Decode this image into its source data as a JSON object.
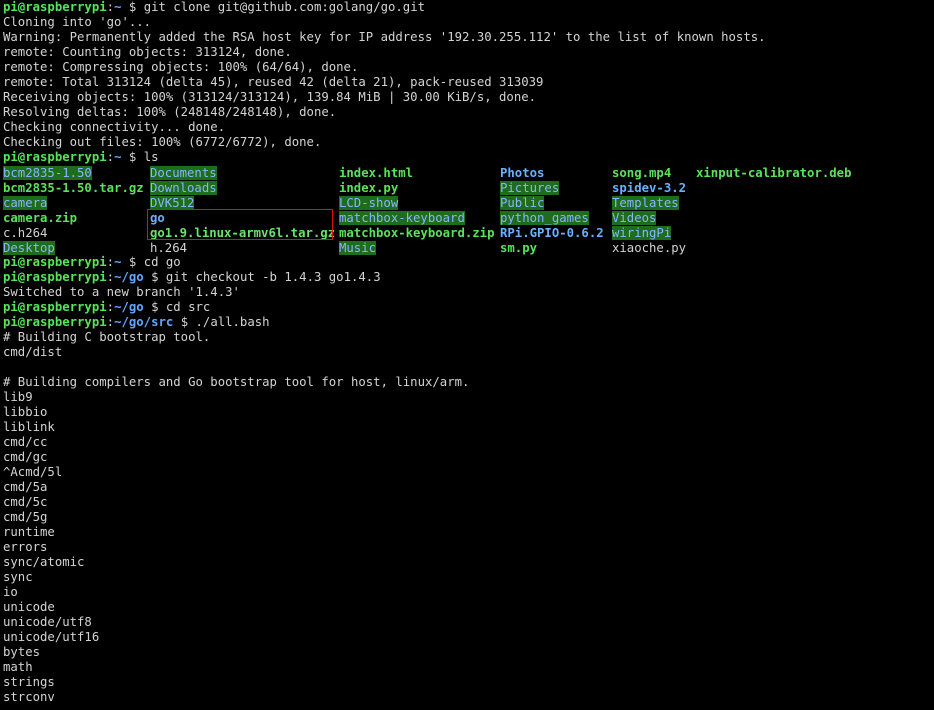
{
  "prompt": {
    "user_host": "pi@raspberrypi",
    "sep": ":"
  },
  "lines_top": [
    {
      "path": "~",
      "cmd": "git clone git@github.com:golang/go.git"
    },
    {
      "text": "Cloning into 'go'..."
    },
    {
      "text": "Warning: Permanently added the RSA host key for IP address '192.30.255.112' to the list of known hosts."
    },
    {
      "text": "remote: Counting objects: 313124, done."
    },
    {
      "text": "remote: Compressing objects: 100% (64/64), done."
    },
    {
      "text": "remote: Total 313124 (delta 45), reused 42 (delta 21), pack-reused 313039"
    },
    {
      "text": "Receiving objects: 100% (313124/313124), 139.84 MiB | 30.00 KiB/s, done."
    },
    {
      "text": "Resolving deltas: 100% (248148/248148), done."
    },
    {
      "text": "Checking connectivity... done."
    },
    {
      "text": "Checking out files: 100% (6772/6772), done."
    },
    {
      "path": "~",
      "cmd": "ls"
    }
  ],
  "ls_rows": [
    [
      "bcm2835-1.50",
      "Documents",
      "index.html",
      "Photos",
      "song.mp4",
      "xinput-calibrator.deb"
    ],
    [
      "bcm2835-1.50.tar.gz",
      "Downloads",
      "index.py",
      "Pictures",
      "spidev-3.2",
      ""
    ],
    [
      "camera",
      "DVK512",
      "LCD-show",
      "Public",
      "Templates",
      ""
    ],
    [
      "camera.zip",
      "go",
      "matchbox-keyboard",
      "python_games",
      "Videos",
      ""
    ],
    [
      "c.h264",
      "go1.9.linux-armv6l.tar.gz",
      "matchbox-keyboard.zip",
      "RPi.GPIO-0.6.2",
      "wiringPi",
      ""
    ],
    [
      "Desktop",
      "h.264",
      "Music",
      "sm.py",
      "xiaoche.py",
      ""
    ]
  ],
  "lines_bottom": [
    {
      "path": "~",
      "cmd": "cd go"
    },
    {
      "path": "~/go",
      "cmd": "git checkout -b 1.4.3 go1.4.3"
    },
    {
      "text": "Switched to a new branch '1.4.3'"
    },
    {
      "path": "~/go",
      "cmd": "cd src"
    },
    {
      "path": "~/go/src",
      "cmd": "./all.bash"
    },
    {
      "text": "# Building C bootstrap tool."
    },
    {
      "text": "cmd/dist"
    },
    {
      "text": ""
    },
    {
      "text": "# Building compilers and Go bootstrap tool for host, linux/arm."
    },
    {
      "text": "lib9"
    },
    {
      "text": "libbio"
    },
    {
      "text": "liblink"
    },
    {
      "text": "cmd/cc"
    },
    {
      "text": "cmd/gc"
    },
    {
      "text": "^Acmd/5l"
    },
    {
      "text": "cmd/5a"
    },
    {
      "text": "cmd/5c"
    },
    {
      "text": "cmd/5g"
    },
    {
      "text": "runtime"
    },
    {
      "text": "errors"
    },
    {
      "text": "sync/atomic"
    },
    {
      "text": "sync"
    },
    {
      "text": "io"
    },
    {
      "text": "unicode"
    },
    {
      "text": "unicode/utf8"
    },
    {
      "text": "unicode/utf16"
    },
    {
      "text": "bytes"
    },
    {
      "text": "math"
    },
    {
      "text": "strings"
    },
    {
      "text": "strconv"
    }
  ],
  "colors": {
    "highlight_box": "#dd1111",
    "prompt_user": "#55e55a",
    "prompt_path": "#5fa8ff",
    "dir_highlight_bg": "#1d6d1d"
  }
}
